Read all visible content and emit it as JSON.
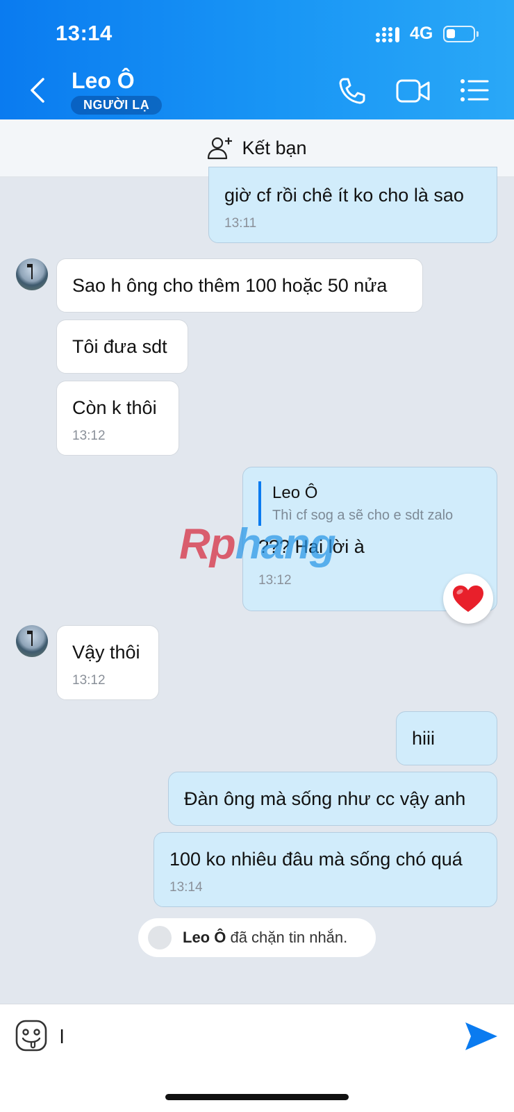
{
  "status_bar": {
    "time": "13:14",
    "network": "4G",
    "battery_level": 0.3
  },
  "header": {
    "contact_name": "Leo Ô",
    "badge": "NGƯỜI LẠ",
    "icons": [
      "back-arrow-icon",
      "phone-icon",
      "video-call-icon",
      "menu-list-icon"
    ]
  },
  "add_friend": {
    "label": "Kết bạn",
    "icon": "add-user-icon"
  },
  "messages": [
    {
      "dir": "out",
      "text": "giờ cf rồi chê ít ko cho là sao",
      "time": "13:11"
    },
    {
      "dir": "in",
      "text": "Sao h ông cho thêm 100 hoặc 50 nửa"
    },
    {
      "dir": "in",
      "text": "Tôi đưa sdt"
    },
    {
      "dir": "in",
      "text": "Còn k thôi",
      "time": "13:12"
    },
    {
      "dir": "out",
      "quote": {
        "name": "Leo Ô",
        "text": "Thì cf sog a sẽ cho e sdt zalo"
      },
      "text": "??? Hai lời à",
      "time": "13:12",
      "reaction": "heart"
    },
    {
      "dir": "in",
      "text": "Vậy thôi",
      "time": "13:12"
    },
    {
      "dir": "out",
      "text": "hiii"
    },
    {
      "dir": "out",
      "text": "Đàn ông mà sống như cc vậy anh"
    },
    {
      "dir": "out",
      "text": "100 ko nhiêu đâu mà sống chó quá",
      "time": "13:14"
    }
  ],
  "system_notice": {
    "name": "Leo Ô",
    "text": " đã chặn tin nhắn."
  },
  "watermark": {
    "part1": "Rp",
    "part2": "hang"
  },
  "composer": {
    "value": "l",
    "placeholder": ""
  },
  "colors": {
    "header_start": "#0a7bf0",
    "header_end": "#2aa8f7",
    "outgoing_bubble": "#d1ecfb",
    "incoming_bubble": "#ffffff",
    "accent": "#0a7bf0"
  }
}
